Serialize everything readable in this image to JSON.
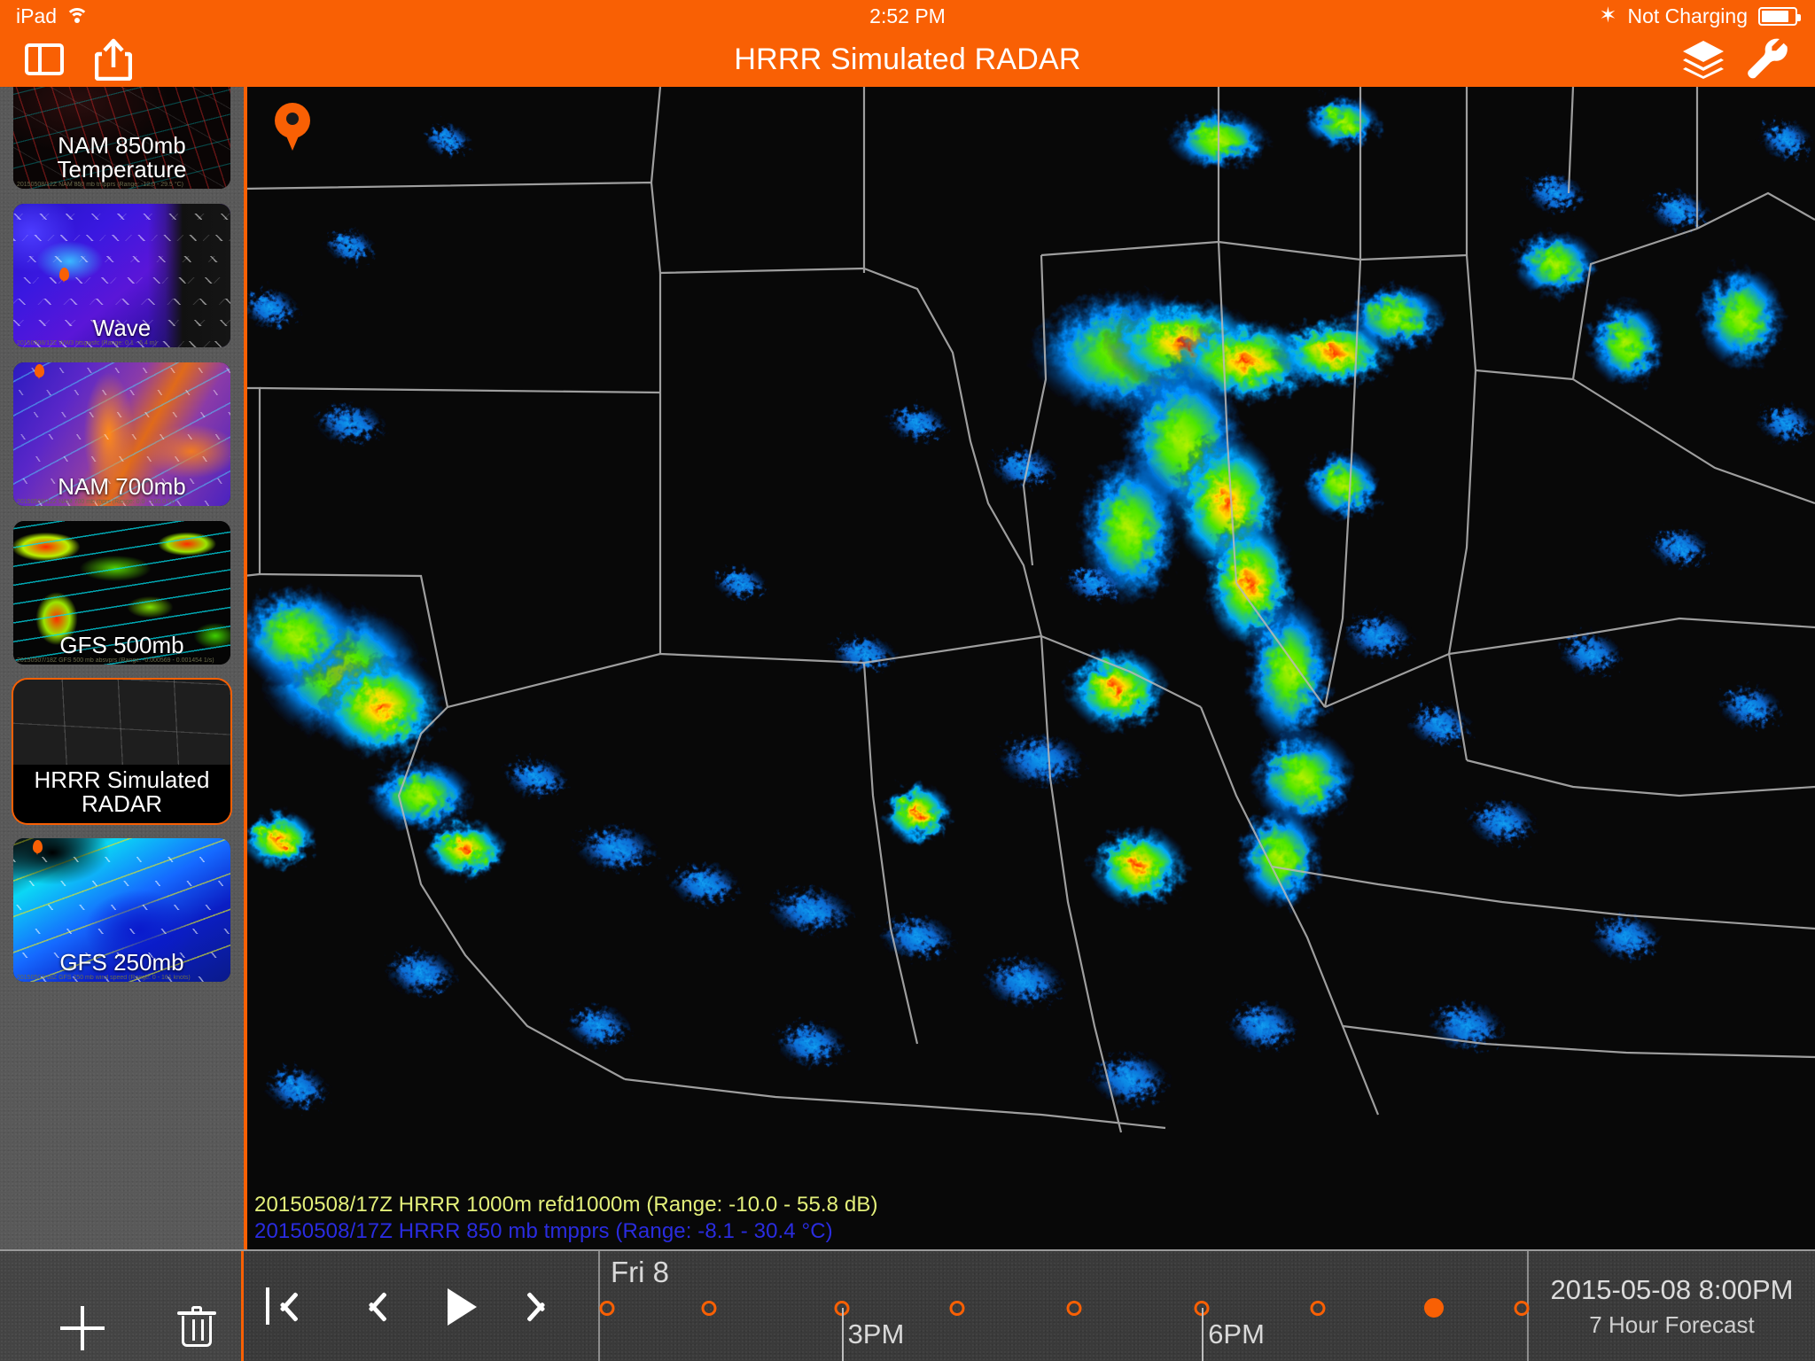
{
  "status_bar": {
    "device": "iPad",
    "wifi_icon": "wifi-icon",
    "time": "2:52 PM",
    "bluetooth_icon": "bluetooth-icon",
    "charging_status": "Not Charging",
    "battery_icon": "battery-icon"
  },
  "nav_bar": {
    "title": "HRRR Simulated RADAR",
    "sidebar_toggle_icon": "sidebar-toggle-icon",
    "share_icon": "share-icon",
    "layers_icon": "layers-icon",
    "settings_icon": "wrench-icon",
    "accent_color": "#f96004"
  },
  "sidebar": {
    "items": [
      {
        "label": "NAM 850mb\nTemperature",
        "line1": "NAM 850mb",
        "line2": "Temperature",
        "selected": false,
        "art": "art-nam850",
        "sub": "20150508/12Z NAM 850 mb tmpprs (Range: -12.0 - 29.5 °C)"
      },
      {
        "label": "Wave",
        "line1": "Wave",
        "line2": "",
        "selected": false,
        "art": "art-wave",
        "sub": "20150508/12Z WW3 htsgwsfc (Range: 0.1 - 6.4 m)"
      },
      {
        "label": "NAM 700mb",
        "line1": "NAM 700mb",
        "line2": "",
        "selected": false,
        "art": "art-nam700",
        "sub": "20150508/12Z NAM 700 mb rhprs (Range: 0.0 - 100.0 %)"
      },
      {
        "label": "GFS 500mb",
        "line1": "GFS 500mb",
        "line2": "",
        "selected": false,
        "art": "art-gfs500",
        "sub": "20150507/18Z GFS 500 mb absvprs (Range: -0.000569 - 0.001454 1/s)"
      },
      {
        "label": "HRRR Simulated RADAR",
        "line1": "HRRR Simulated RADAR",
        "line2": "",
        "selected": true,
        "art": "art-hrrr",
        "sub": "20150508/17Z HRRR 1000m refd1000m"
      },
      {
        "label": "GFS 250mb",
        "line1": "GFS 250mb",
        "line2": "",
        "selected": false,
        "art": "art-gfs250",
        "sub": "20150507/18Z GFS 250 mb wind speed (Range: 0 - 161 knots)"
      }
    ]
  },
  "map": {
    "pin_icon": "location-pin-icon",
    "legend": {
      "line1": "20150508/17Z HRRR 1000m refd1000m (Range: -10.0 - 55.8 dB)",
      "line1_color": "#e3ef7a",
      "line2": "20150508/17Z HRRR 850 mb tmpprs (Range: -8.1 - 30.4 °C)",
      "line2_color": "#2a2ce0"
    }
  },
  "bottom_bar": {
    "add_icon": "plus-icon",
    "delete_icon": "trash-icon",
    "transport": {
      "skip_start_icon": "skip-to-start-icon",
      "step_back_icon": "step-backward-icon",
      "play_icon": "play-icon",
      "step_forward_icon": "step-forward-icon"
    },
    "timeline": {
      "day_label": "Fri 8",
      "hour_labels": [
        {
          "text": "3PM",
          "pos_pct": 26.4
        },
        {
          "text": "6PM",
          "pos_pct": 65.2
        }
      ],
      "ticks": [
        {
          "pos_pct": 1.0,
          "active": false
        },
        {
          "pos_pct": 11.9,
          "active": false
        },
        {
          "pos_pct": 26.2,
          "active": false
        },
        {
          "pos_pct": 38.6,
          "active": false
        },
        {
          "pos_pct": 51.2,
          "active": false
        },
        {
          "pos_pct": 65.0,
          "active": false
        },
        {
          "pos_pct": 77.5,
          "active": false
        },
        {
          "pos_pct": 90.0,
          "active": true
        },
        {
          "pos_pct": 99.4,
          "active": false
        }
      ]
    },
    "readout": {
      "datetime": "2015-05-08 8:00PM",
      "forecast": "7 Hour Forecast"
    }
  }
}
